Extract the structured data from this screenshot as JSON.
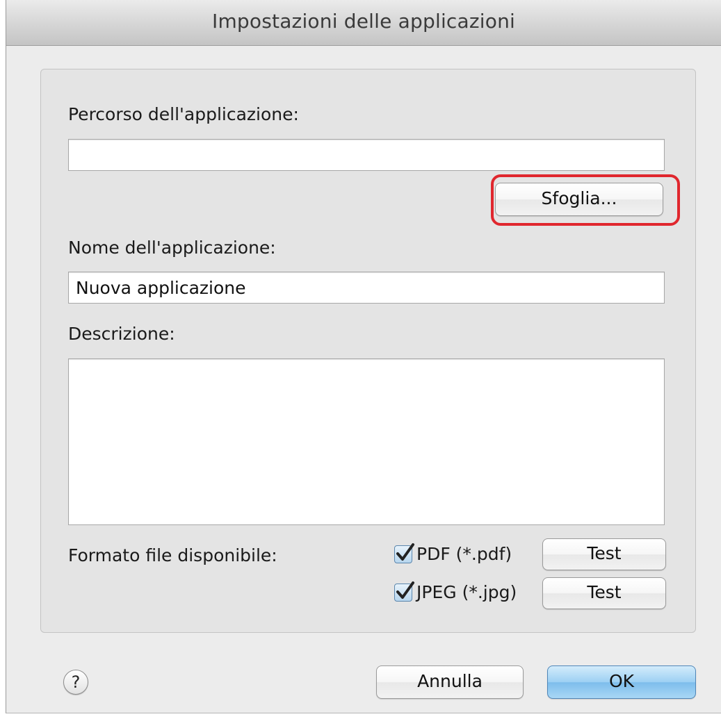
{
  "window": {
    "title": "Impostazioni delle applicazioni"
  },
  "form": {
    "path_label": "Percorso dell'applicazione:",
    "path_value": "",
    "browse_button": "Sfoglia...",
    "name_label": "Nome dell'applicazione:",
    "name_value": "Nuova applicazione",
    "description_label": "Descrizione:",
    "description_value": "",
    "format_label": "Formato file disponibile:",
    "formats": [
      {
        "label": "PDF (*.pdf)",
        "checked": true,
        "test_button": "Test"
      },
      {
        "label": "JPEG (*.jpg)",
        "checked": true,
        "test_button": "Test"
      }
    ]
  },
  "footer": {
    "help_glyph": "?",
    "cancel_button": "Annulla",
    "ok_button": "OK"
  },
  "annotation": {
    "highlight_color": "#e0272e"
  }
}
